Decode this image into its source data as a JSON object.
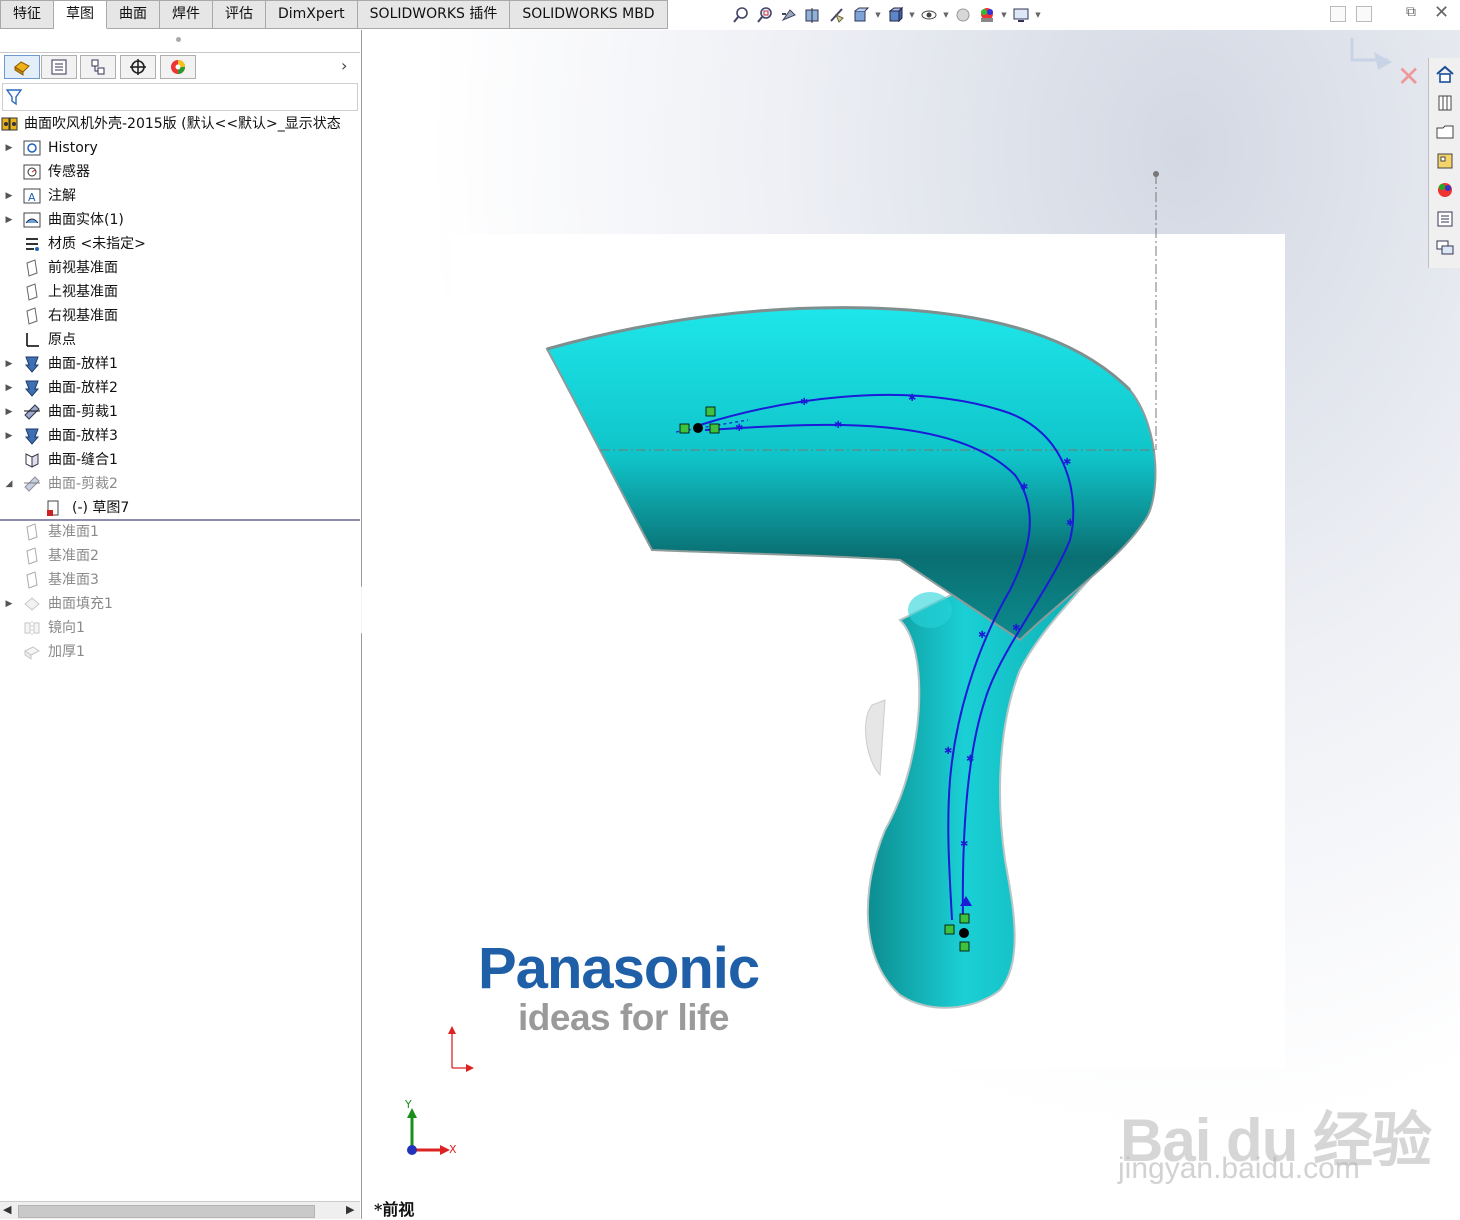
{
  "command_tabs": [
    "特征",
    "草图",
    "曲面",
    "焊件",
    "评估",
    "DimXpert",
    "SOLIDWORKS 插件",
    "SOLIDWORKS MBD"
  ],
  "active_tab": "草图",
  "view_toolbar_icons": [
    "zoom-to-fit-icon",
    "zoom-area-icon",
    "previous-view-icon",
    "section-view-icon",
    "dynamic-annotation-icon",
    "display-style-icon",
    "view-orientation-icon",
    "hide-show-icon",
    "edit-appearance-icon",
    "apply-scene-icon",
    "view-settings-icon"
  ],
  "manager_tabs": [
    "featuremanager-icon",
    "propertymanager-icon",
    "configurationmanager-icon",
    "dimxpert-icon",
    "displaymanager-icon"
  ],
  "tree": {
    "root": "曲面吹风机外壳-2015版  (默认<<默认>_显示状态",
    "items": [
      {
        "label": "History",
        "icon": "history-icon",
        "expandable": true,
        "dim": false
      },
      {
        "label": "传感器",
        "icon": "sensor-icon",
        "expandable": false,
        "dim": false
      },
      {
        "label": "注解",
        "icon": "annotation-icon",
        "expandable": true,
        "dim": false
      },
      {
        "label": "曲面实体(1)",
        "icon": "surface-bodies-icon",
        "expandable": true,
        "dim": false
      },
      {
        "label": "材质 <未指定>",
        "icon": "material-icon",
        "expandable": false,
        "dim": false
      },
      {
        "label": "前视基准面",
        "icon": "plane-icon",
        "expandable": false,
        "dim": false
      },
      {
        "label": "上视基准面",
        "icon": "plane-icon",
        "expandable": false,
        "dim": false
      },
      {
        "label": "右视基准面",
        "icon": "plane-icon",
        "expandable": false,
        "dim": false
      },
      {
        "label": "原点",
        "icon": "origin-icon",
        "expandable": false,
        "dim": false
      },
      {
        "label": "曲面-放样1",
        "icon": "loft-icon",
        "expandable": true,
        "dim": false
      },
      {
        "label": "曲面-放样2",
        "icon": "loft-icon",
        "expandable": true,
        "dim": false
      },
      {
        "label": "曲面-剪裁1",
        "icon": "trim-icon",
        "expandable": true,
        "dim": false
      },
      {
        "label": "曲面-放样3",
        "icon": "loft-icon",
        "expandable": true,
        "dim": false
      },
      {
        "label": "曲面-缝合1",
        "icon": "knit-icon",
        "expandable": false,
        "dim": false
      },
      {
        "label": "曲面-剪裁2",
        "icon": "trim-icon",
        "expandable": true,
        "dim": true,
        "expanded": true
      },
      {
        "label": "(-)  草图7",
        "icon": "sketch-icon",
        "expandable": false,
        "dim": false,
        "child": true
      },
      {
        "label": "基准面1",
        "icon": "plane-icon",
        "expandable": false,
        "dim": true
      },
      {
        "label": "基准面2",
        "icon": "plane-icon",
        "expandable": false,
        "dim": true
      },
      {
        "label": "基准面3",
        "icon": "plane-icon",
        "expandable": false,
        "dim": true
      },
      {
        "label": "曲面填充1",
        "icon": "fill-icon",
        "expandable": true,
        "dim": true
      },
      {
        "label": "镜向1",
        "icon": "mirror-icon",
        "expandable": false,
        "dim": true
      },
      {
        "label": "加厚1",
        "icon": "thicken-icon",
        "expandable": false,
        "dim": true
      }
    ]
  },
  "task_pane_icons": [
    "home-icon",
    "design-library-icon",
    "file-explorer-icon",
    "view-palette-icon",
    "appearances-icon",
    "custom-properties-icon",
    "forum-icon"
  ],
  "viewport": {
    "view_label": "*前视",
    "brand_name": "Panasonic",
    "brand_slogan": "ideas for life",
    "triad_x": "X",
    "triad_y": "Y",
    "watermark_line1": "Bai du 经验",
    "watermark_line2": "jingyan.baidu.com"
  },
  "colors": {
    "dryer_teal": "#0fb6bb",
    "spline_blue": "#1b1bd8",
    "brand_blue": "#1f5fa8"
  }
}
